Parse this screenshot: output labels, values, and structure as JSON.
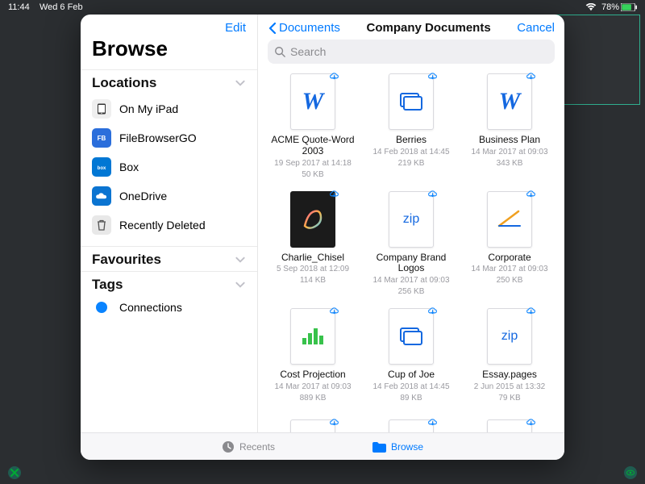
{
  "statusbar": {
    "time": "11:44",
    "date": "Wed 6 Feb",
    "battery": "78%"
  },
  "sidebar": {
    "edit": "Edit",
    "title": "Browse",
    "locations_header": "Locations",
    "favourites_header": "Favourites",
    "tags_header": "Tags",
    "locations": [
      {
        "label": "On My iPad"
      },
      {
        "label": "FileBrowserGO"
      },
      {
        "label": "Box"
      },
      {
        "label": "OneDrive"
      },
      {
        "label": "Recently Deleted"
      }
    ],
    "tags": [
      {
        "label": "Connections",
        "color": "#0a84ff"
      }
    ]
  },
  "main": {
    "back": "Documents",
    "title": "Company Documents",
    "cancel": "Cancel",
    "search_placeholder": "Search"
  },
  "files": [
    {
      "name": "ACME Quote-Word 2003",
      "date": "19 Sep 2017 at 14:18",
      "size": "50 KB",
      "kind": "word"
    },
    {
      "name": "Berries",
      "date": "14 Feb 2018 at 14:45",
      "size": "219 KB",
      "kind": "folder"
    },
    {
      "name": "Business Plan",
      "date": "14 Mar 2017 at 09:03",
      "size": "343 KB",
      "kind": "word"
    },
    {
      "name": "Charlie_Chisel",
      "date": "5 Sep 2018 at 12:09",
      "size": "114 KB",
      "kind": "procreate"
    },
    {
      "name": "Company Brand Logos",
      "date": "14 Mar 2017 at 09:03",
      "size": "256 KB",
      "kind": "zip"
    },
    {
      "name": "Corporate",
      "date": "14 Mar 2017 at 09:03",
      "size": "250 KB",
      "kind": "keynote"
    },
    {
      "name": "Cost Projection",
      "date": "14 Mar 2017 at 09:03",
      "size": "889 KB",
      "kind": "numbers"
    },
    {
      "name": "Cup of Joe",
      "date": "14 Feb 2018 at 14:45",
      "size": "89 KB",
      "kind": "folder"
    },
    {
      "name": "Essay.pages",
      "date": "2 Jun 2015 at 13:32",
      "size": "79 KB",
      "kind": "zip"
    }
  ],
  "files_row4": [
    {
      "kind": "word"
    },
    {
      "kind": "excelE"
    },
    {
      "kind": "excelE"
    }
  ],
  "toolbar": {
    "recents": "Recents",
    "browse": "Browse"
  }
}
